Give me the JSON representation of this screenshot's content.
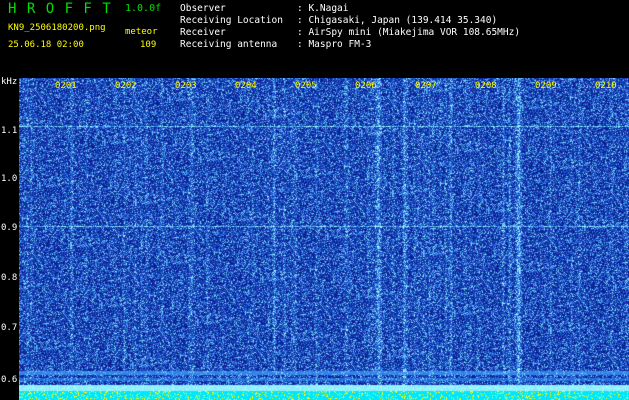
{
  "app": {
    "name": "H R O F F T",
    "version": "1.0.0f",
    "filename": "KN9_2506180200.png",
    "datetime": "25.06.18 02:00",
    "meteor_label": "meteor",
    "meteor_count": "109"
  },
  "info": [
    {
      "label": "Observer",
      "value": ": K.Nagai"
    },
    {
      "label": "Receiving Location",
      "value": ": Chigasaki, Japan (139.414 35.340)"
    },
    {
      "label": "Receiver",
      "value": ": AirSpy mini (Miakejima VOR 108.65MHz)"
    },
    {
      "label": "Receiving antenna",
      "value": ": Maspro FM-3"
    }
  ],
  "waterfall": {
    "freq_unit": "kHz",
    "freq_ticks": [
      "1.1",
      "1.0",
      "0.9",
      "0.8",
      "0.7",
      "0.6"
    ],
    "time_labels": [
      "0201",
      "0202",
      "0203",
      "0204",
      "0205",
      "0206",
      "0207",
      "0208",
      "0209",
      "0210"
    ],
    "colors": {
      "background": "#000000",
      "noise_low": "#0a1a8c",
      "noise_high": "#3fd0ff",
      "label": "#ffff00",
      "tick": "#00e000"
    }
  }
}
